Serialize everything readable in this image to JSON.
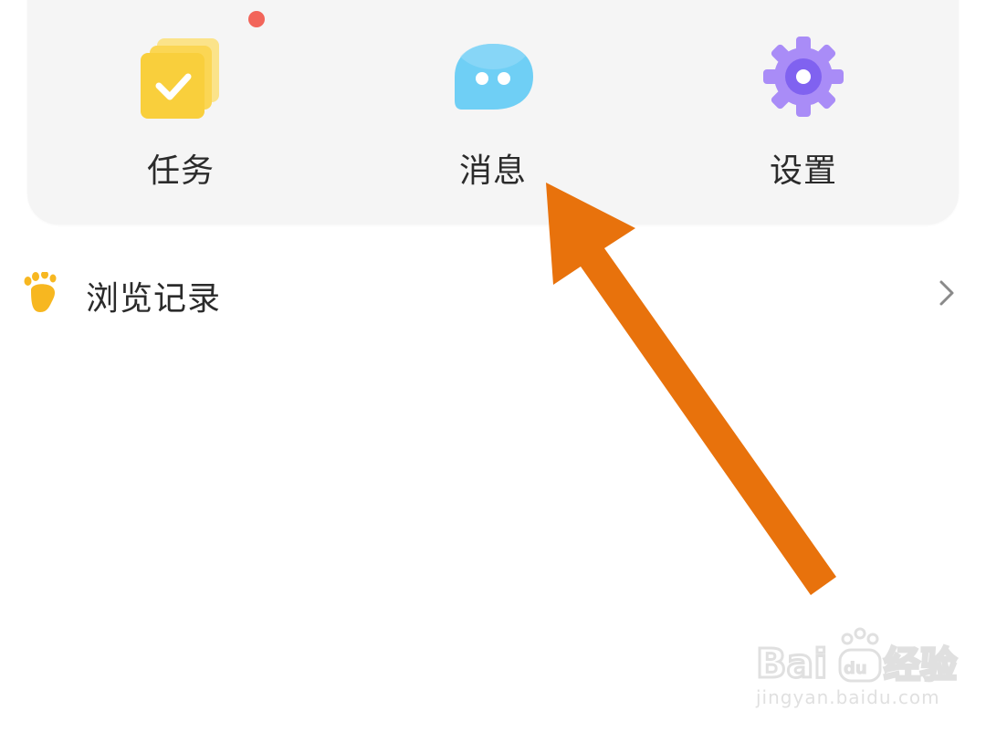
{
  "shortcuts": [
    {
      "label": "任务",
      "icon": "task-stack-icon",
      "color": "#f9cf3c",
      "has_badge": true
    },
    {
      "label": "消息",
      "icon": "chat-bubble-icon",
      "color": "#6fcff5",
      "has_badge": false
    },
    {
      "label": "设置",
      "icon": "gear-icon",
      "color": "#8f6bf4",
      "has_badge": false
    }
  ],
  "history": {
    "label": "浏览记录",
    "icon": "footprint-icon",
    "icon_color": "#f7b720"
  },
  "annotation": {
    "color": "#e8720c"
  },
  "watermark": {
    "brand": "Bai经验",
    "url": "jingyan.baidu.com"
  },
  "colors": {
    "card_bg": "#f5f5f5",
    "badge": "#f2655a",
    "text": "#2b2b2b"
  }
}
